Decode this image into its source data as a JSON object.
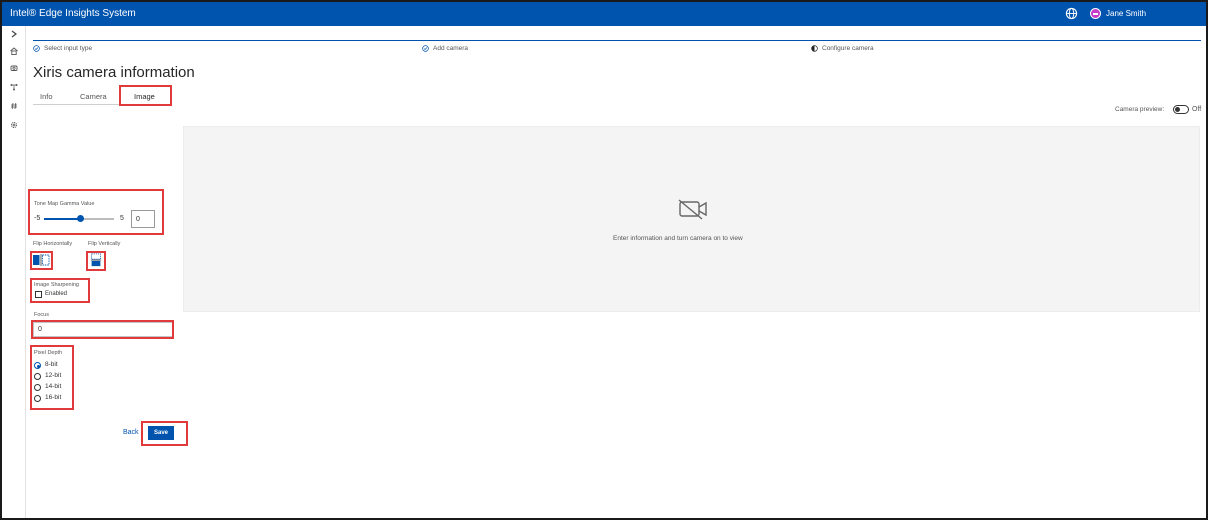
{
  "app": {
    "title": "Intel® Edge Insights System"
  },
  "user": {
    "name": "Jane Smith"
  },
  "steps": [
    {
      "label": "Select input type",
      "state": "done"
    },
    {
      "label": "Add camera",
      "state": "done"
    },
    {
      "label": "Configure camera",
      "state": "current"
    }
  ],
  "page": {
    "title": "Xiris camera information"
  },
  "tabs": [
    {
      "label": "Info",
      "active": false
    },
    {
      "label": "Camera",
      "active": false
    },
    {
      "label": "Image",
      "active": true
    }
  ],
  "preview": {
    "toggle_label": "Camera preview:",
    "toggle_state": "Off",
    "message": "Enter information and turn camera on to view"
  },
  "form": {
    "tone_map": {
      "label": "Tone Map Gamma Value",
      "min": "-5",
      "max": "5",
      "value": "0",
      "slider_fraction": 0.5
    },
    "flip_horizontally": {
      "label": "Flip Horizontally"
    },
    "flip_vertically": {
      "label": "Flip Vertically"
    },
    "sharpening": {
      "label": "Image Sharpening",
      "option": "Enabled",
      "checked": false
    },
    "focus": {
      "label": "Focus",
      "value": "0"
    },
    "pixel_depth": {
      "label": "Pixel Depth",
      "options": [
        "8-bit",
        "12-bit",
        "14-bit",
        "16-bit"
      ],
      "selected": "8-bit"
    }
  },
  "actions": {
    "back": "Back",
    "save": "Save"
  },
  "colors": {
    "brand": "#0054ae",
    "highlight": "#e03a3a",
    "avatar": "#c43cc8"
  }
}
